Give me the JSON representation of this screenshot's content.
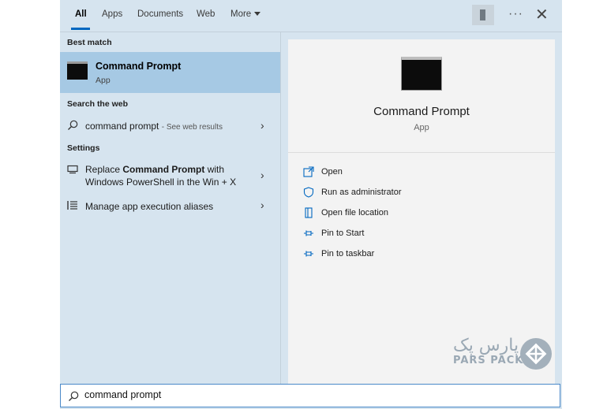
{
  "tabs": [
    {
      "label": "All",
      "active": true
    },
    {
      "label": "Apps"
    },
    {
      "label": "Documents"
    },
    {
      "label": "Web"
    },
    {
      "label": "More"
    }
  ],
  "top_actions": {
    "options": "···",
    "close": "✕"
  },
  "best_match": {
    "heading": "Best match",
    "title": "Command Prompt",
    "subtitle": "App"
  },
  "search_web": {
    "heading": "Search the web",
    "query": "command prompt",
    "suffix": "- See web results"
  },
  "settings": {
    "heading": "Settings",
    "items": [
      {
        "pre": "Replace ",
        "bold": "Command Prompt",
        "post": " with",
        "line2": "Windows PowerShell in the Win + X",
        "icon": "monitor-icon"
      },
      {
        "text": "Manage app execution aliases",
        "icon": "list-icon"
      }
    ]
  },
  "detail": {
    "title": "Command Prompt",
    "subtitle": "App",
    "actions": [
      {
        "label": "Open",
        "icon": "open-icon"
      },
      {
        "label": "Run as administrator",
        "icon": "shield-icon"
      },
      {
        "label": "Open file location",
        "icon": "file-location-icon"
      },
      {
        "label": "Pin to Start",
        "icon": "pin-icon"
      },
      {
        "label": "Pin to taskbar",
        "icon": "pin-icon"
      }
    ]
  },
  "watermark": {
    "fa": "پارس پک",
    "en": "PARS PACK"
  },
  "search": {
    "value": "command prompt"
  },
  "colors": {
    "accent": "#0067c0",
    "selected": "#a6c9e4",
    "panel": "#d6e4ef"
  }
}
